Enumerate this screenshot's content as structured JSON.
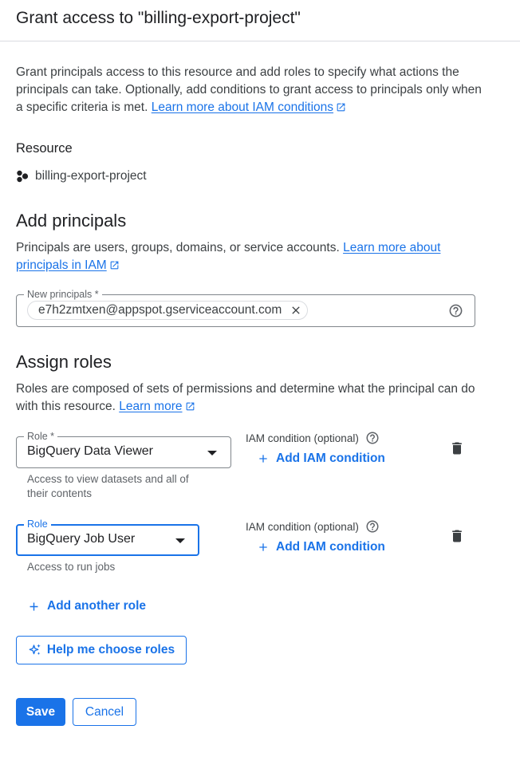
{
  "header": {
    "title": "Grant access to \"billing-export-project\""
  },
  "intro": {
    "text": "Grant principals access to this resource and add roles to specify what actions the principals can take. Optionally, add conditions to grant access to principals only when a specific criteria is met.",
    "link_label": "Learn more about IAM conditions"
  },
  "resource": {
    "heading": "Resource",
    "name": "billing-export-project",
    "icon": "project-icon"
  },
  "add_principals": {
    "title": "Add principals",
    "text": "Principals are users, groups, domains, or service accounts.",
    "link_label": "Learn more about principals in IAM",
    "field_label": "New principals *",
    "chips": [
      "e7h2zmtxen@appspot.gserviceaccount.com"
    ]
  },
  "assign_roles": {
    "title": "Assign roles",
    "text": "Roles are composed of sets of permissions and determine what the principal can do with this resource.",
    "link_label": "Learn more",
    "roles": [
      {
        "field_label": "Role *",
        "value": "BigQuery Data Viewer",
        "hint": "Access to view datasets and all of their contents",
        "condition_label": "IAM condition (optional)",
        "add_condition_label": "Add IAM condition"
      },
      {
        "field_label": "Role",
        "value": "BigQuery Job User",
        "hint": "Access to run jobs",
        "condition_label": "IAM condition (optional)",
        "add_condition_label": "Add IAM condition"
      }
    ],
    "add_role_label": "Add another role",
    "help_choose_label": "Help me choose roles"
  },
  "actions": {
    "save_label": "Save",
    "cancel_label": "Cancel"
  },
  "colors": {
    "accent": "#1a73e8",
    "focused_border": "#1a73e8",
    "text_primary": "#202124",
    "text_secondary": "#5f6368",
    "border": "#80868b"
  }
}
